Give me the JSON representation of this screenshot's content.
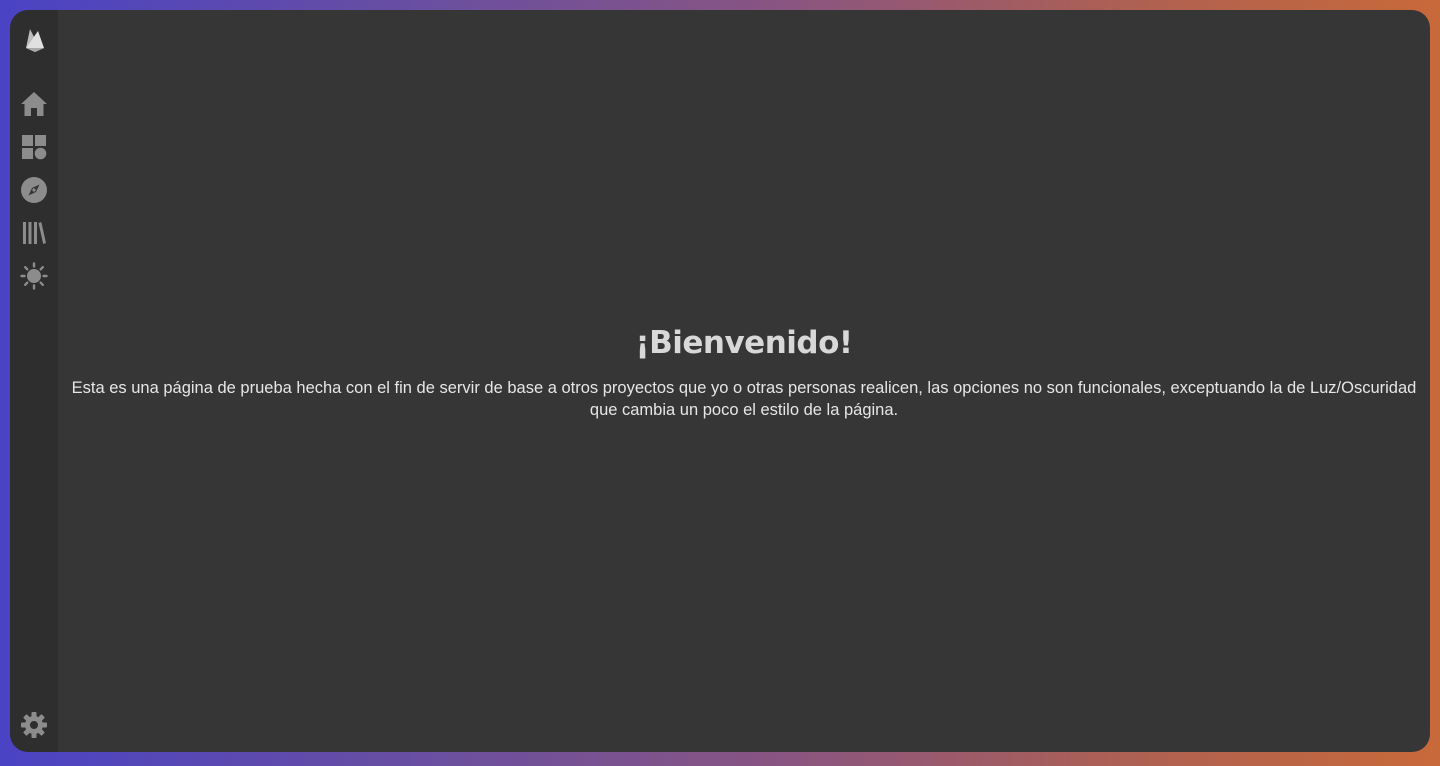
{
  "sidebar": {
    "logo_icon": "firebase-flame-icon",
    "items": [
      {
        "id": "home",
        "icon": "home-icon"
      },
      {
        "id": "dashboard",
        "icon": "dashboard-icon"
      },
      {
        "id": "explore",
        "icon": "compass-icon"
      },
      {
        "id": "library",
        "icon": "library-icon"
      },
      {
        "id": "theme",
        "icon": "sun-icon"
      }
    ],
    "settings_icon": "gear-icon",
    "icon_color": "#8c8c8c"
  },
  "main": {
    "title": "¡Bienvenido!",
    "description": "Esta es una página de prueba hecha con el fin de servir de base a otros proyectos que yo o otras personas realicen, las opciones no son funcionales, exceptuando la de Luz/Oscuridad que cambia un poco el estilo de la página."
  },
  "colors": {
    "panel_background": "#363636",
    "sidebar_background": "#2e2e2e",
    "title_color": "#d8d8d8",
    "text_color": "#e6e6e6",
    "gradient_left": "#4a43c4",
    "gradient_right": "#c8693a"
  }
}
